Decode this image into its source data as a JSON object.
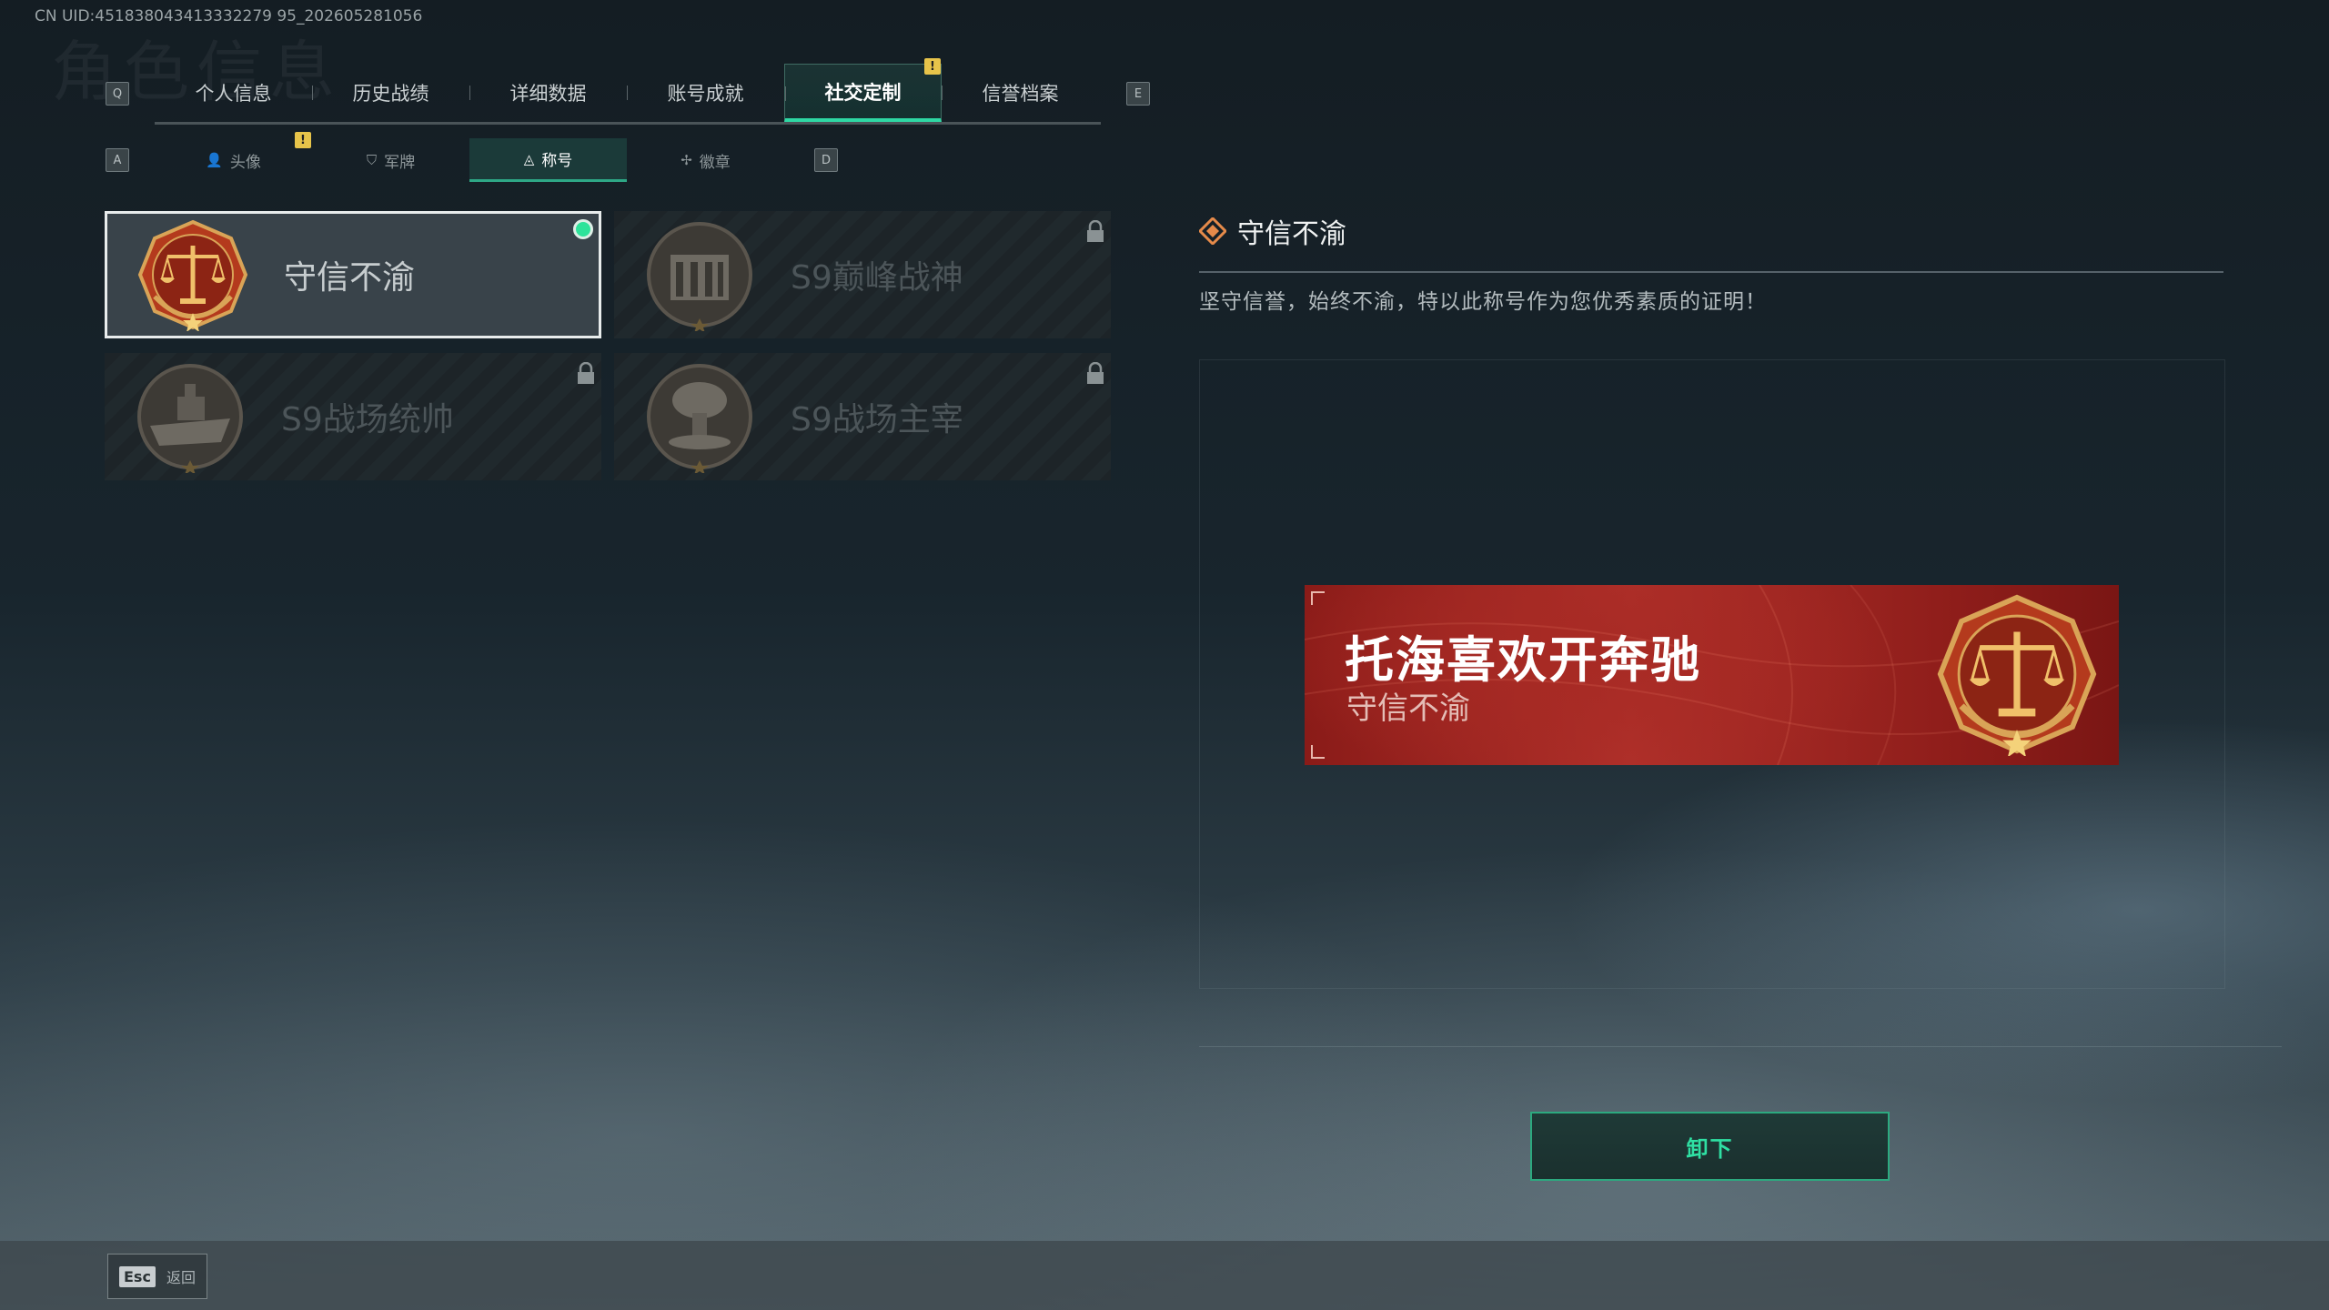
{
  "header": {
    "uid": "CN UID:451838043413332279 95_202605281056"
  },
  "tabs": {
    "prev_key": "Q",
    "next_key": "E",
    "items": [
      {
        "label": "个人信息"
      },
      {
        "label": "历史战绩"
      },
      {
        "label": "详细数据"
      },
      {
        "label": "账号成就"
      },
      {
        "label": "社交定制",
        "active": true,
        "badge": "!"
      },
      {
        "label": "信誉档案"
      }
    ]
  },
  "subtabs": {
    "prev_key": "A",
    "next_key": "D",
    "items": [
      {
        "label": "头像",
        "icon": "person-icon",
        "badge": "!"
      },
      {
        "label": "军牌",
        "icon": "dogtag-icon"
      },
      {
        "label": "称号",
        "icon": "title-icon",
        "active": true
      },
      {
        "label": "徽章",
        "icon": "emblem-icon"
      }
    ]
  },
  "titles": [
    {
      "name": "守信不渝",
      "medal": "scales-medal",
      "equipped": true,
      "locked": false
    },
    {
      "name": "S9巅峰战神",
      "medal": "building-medal",
      "locked": true
    },
    {
      "name": "S9战场统帅",
      "medal": "battleship-medal",
      "locked": true
    },
    {
      "name": "S9战场主宰",
      "medal": "mushroom-cloud-medal",
      "locked": true
    }
  ],
  "detail": {
    "name": "守信不渝",
    "description": "坚守信誉，始终不渝，特以此称号作为您优秀素质的证明！"
  },
  "banner": {
    "player_name": "托海喜欢开奔驰",
    "title": "守信不渝"
  },
  "actions": {
    "unequip_label": "卸下"
  },
  "footer": {
    "esc_key": "Esc",
    "back_label": "返回"
  },
  "colors": {
    "accent_green": "#2ee39a",
    "badge_yellow": "#e7c44a",
    "banner_red": "#a72a24"
  }
}
